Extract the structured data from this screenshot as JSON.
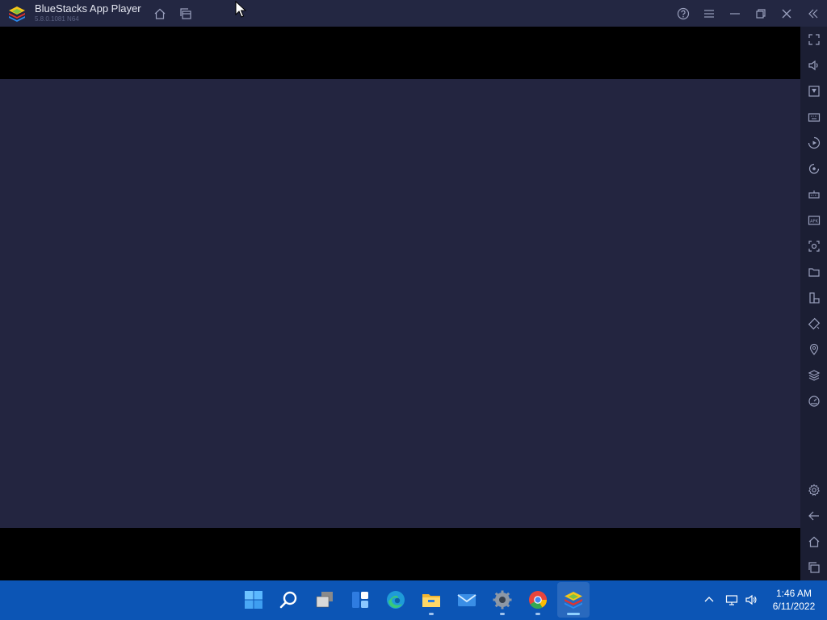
{
  "window": {
    "title": "BlueStacks App Player",
    "version": "5.8.0.1081 N64"
  },
  "titlebar_icons": [
    "home-icon",
    "multi-instance-icon",
    "help-icon",
    "menu-icon",
    "minimize-icon",
    "restore-icon",
    "close-icon",
    "collapse-sidebar-icon"
  ],
  "sidebar_icons": [
    "fullscreen-icon",
    "volume-icon",
    "media-manager-icon",
    "keyboard-controls-icon",
    "macro-record-icon",
    "sync-icon",
    "game-controls-icon",
    "install-apk-icon",
    "screenshot-icon",
    "folder-icon",
    "rotate-icon",
    "shake-icon",
    "location-icon",
    "layers-icon",
    "eco-mode-icon",
    "settings-icon",
    "back-icon",
    "android-home-icon",
    "recent-apps-icon"
  ],
  "taskbar": {
    "apps": [
      "start-icon",
      "search-icon",
      "task-view-icon",
      "widgets-icon",
      "edge-icon",
      "file-explorer-icon",
      "mail-icon",
      "settings-app-icon",
      "chrome-icon",
      "bluestacks-icon"
    ]
  },
  "clock": {
    "time": "1:46 AM",
    "date": "6/11/2022"
  },
  "colors": {
    "titlebar": "#232742",
    "android_screen": "#232540",
    "sidebar": "#1b1e33",
    "taskbar": "#0c55b5"
  }
}
